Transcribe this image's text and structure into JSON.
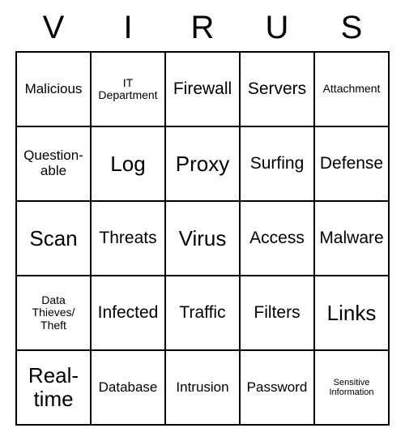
{
  "header": [
    "V",
    "I",
    "R",
    "U",
    "S"
  ],
  "grid": [
    [
      {
        "text": "Malicious",
        "size": "fs-m"
      },
      {
        "text": "IT Department",
        "size": "fs-s"
      },
      {
        "text": "Firewall",
        "size": "fs-l"
      },
      {
        "text": "Servers",
        "size": "fs-l"
      },
      {
        "text": "Attachment",
        "size": "fs-s"
      }
    ],
    [
      {
        "text": "Question-able",
        "size": "fs-m"
      },
      {
        "text": "Log",
        "size": "fs-xl"
      },
      {
        "text": "Proxy",
        "size": "fs-xl"
      },
      {
        "text": "Surfing",
        "size": "fs-l"
      },
      {
        "text": "Defense",
        "size": "fs-l"
      }
    ],
    [
      {
        "text": "Scan",
        "size": "fs-xl"
      },
      {
        "text": "Threats",
        "size": "fs-l"
      },
      {
        "text": "Virus",
        "size": "fs-xl"
      },
      {
        "text": "Access",
        "size": "fs-l"
      },
      {
        "text": "Malware",
        "size": "fs-l"
      }
    ],
    [
      {
        "text": "Data Thieves/\nTheft",
        "size": "fs-s"
      },
      {
        "text": "Infected",
        "size": "fs-l"
      },
      {
        "text": "Traffic",
        "size": "fs-l"
      },
      {
        "text": "Filters",
        "size": "fs-l"
      },
      {
        "text": "Links",
        "size": "fs-xl"
      }
    ],
    [
      {
        "text": "Real-time",
        "size": "fs-xl"
      },
      {
        "text": "Database",
        "size": "fs-m"
      },
      {
        "text": "Intrusion",
        "size": "fs-m"
      },
      {
        "text": "Password",
        "size": "fs-m"
      },
      {
        "text": "Sensitive Information",
        "size": "fs-xs"
      }
    ]
  ]
}
